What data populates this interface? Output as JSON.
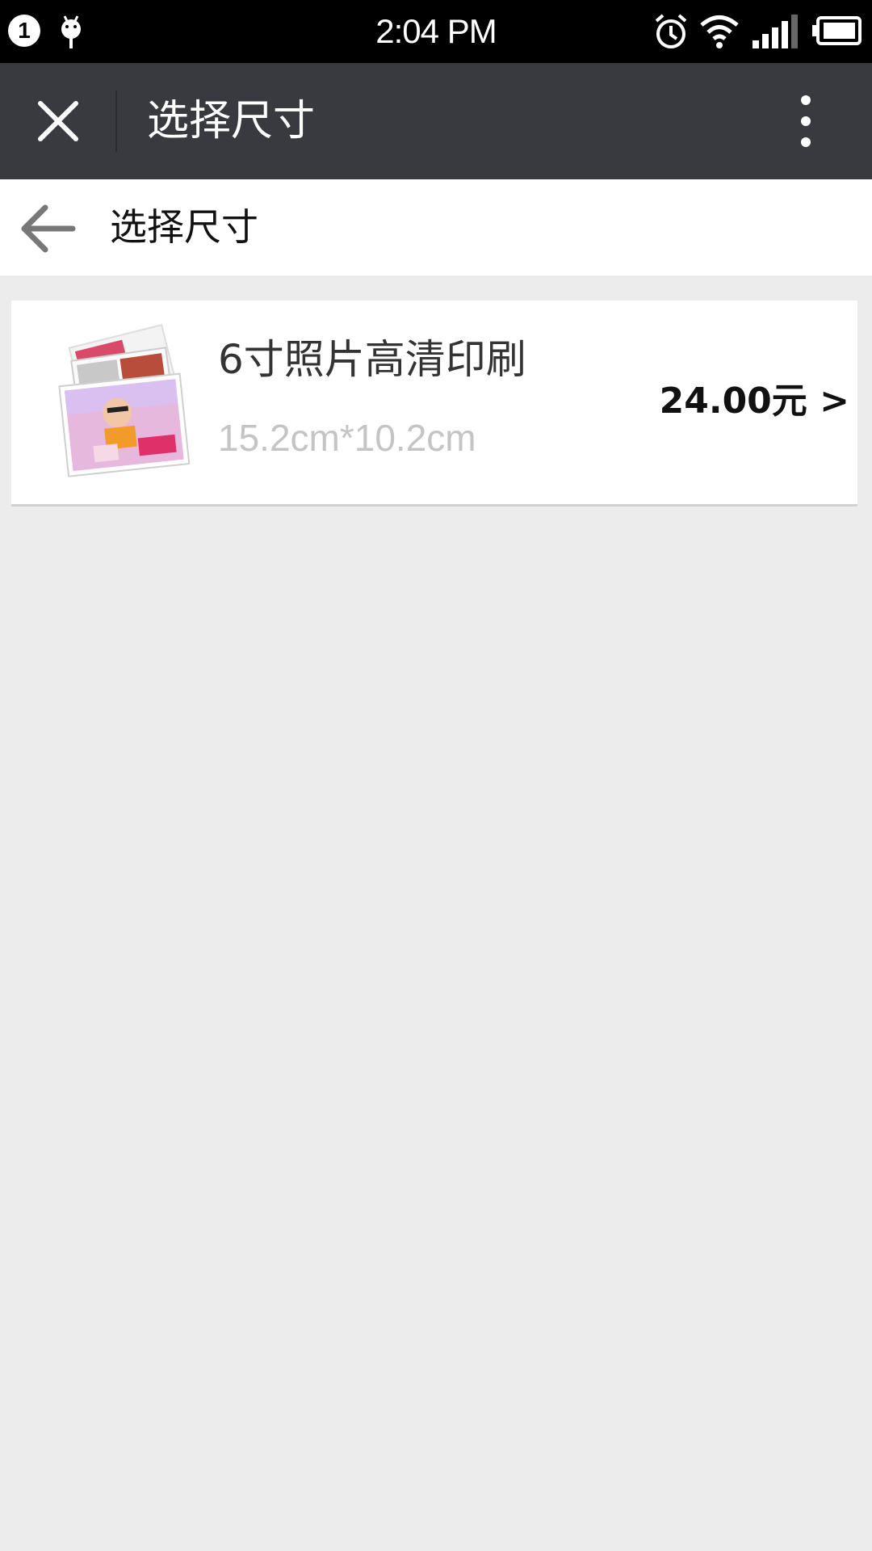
{
  "status_bar": {
    "notification_count": "1",
    "time": "2:04 PM",
    "icons": [
      "android-debug-icon",
      "alarm-icon",
      "wifi-icon",
      "signal-icon",
      "battery-icon"
    ]
  },
  "title_bar": {
    "title": "选择尺寸",
    "close_icon": "close-icon",
    "more_icon": "more-vertical-icon",
    "background": "#393a3f"
  },
  "sub_header": {
    "title": "选择尺寸",
    "back_icon": "back-arrow-icon"
  },
  "products": [
    {
      "name": "6寸照片高清印刷",
      "size": "15.2cm*10.2cm",
      "price": "24.00元 >"
    }
  ],
  "colors": {
    "page_background": "#ececec",
    "card_background": "#ffffff",
    "size_text": "#c4c4c4"
  }
}
